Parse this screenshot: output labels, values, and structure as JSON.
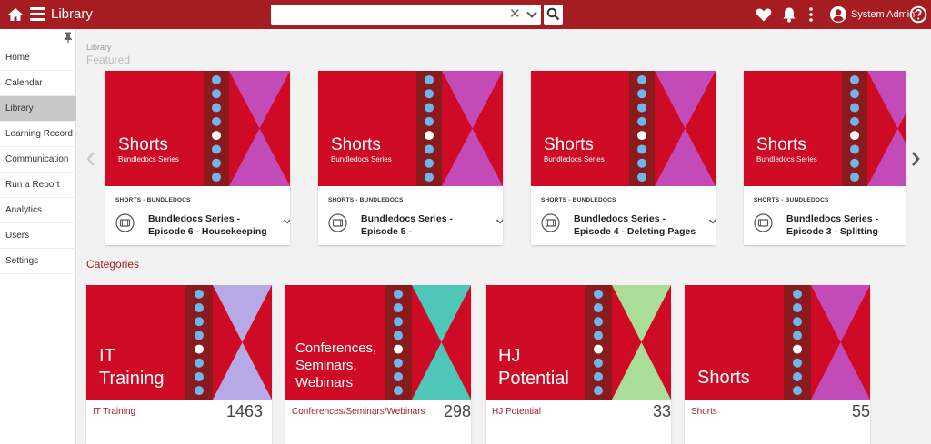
{
  "header": {
    "title": "Library",
    "user_name": "System Admin",
    "search": {
      "value": "",
      "placeholder": ""
    }
  },
  "sidebar": {
    "items": [
      {
        "label": "Home",
        "active": false
      },
      {
        "label": "Calendar",
        "active": false
      },
      {
        "label": "Library",
        "active": true
      },
      {
        "label": "Learning Record",
        "active": false
      },
      {
        "label": "Communication",
        "active": false
      },
      {
        "label": "Run a Report",
        "active": false
      },
      {
        "label": "Analytics",
        "active": false
      },
      {
        "label": "Users",
        "active": false
      },
      {
        "label": "Settings",
        "active": false
      }
    ]
  },
  "main": {
    "breadcrumb": "Library",
    "featured_heading": "Featured",
    "categories_heading": "Categories",
    "featured": [
      {
        "thumb_title": "Shorts",
        "thumb_subtitle": "Bundledocs Series",
        "tag": "SHORTS - BUNDLEDOCS",
        "title_line1": "Bundledocs Series -",
        "title_line2": "Episode 6 - Housekeeping"
      },
      {
        "thumb_title": "Shorts",
        "thumb_subtitle": "Bundledocs Series",
        "tag": "SHORTS - BUNDLEDOCS",
        "title_line1": "Bundledocs Series -",
        "title_line2": "Episode 5 -"
      },
      {
        "thumb_title": "Shorts",
        "thumb_subtitle": "Bundledocs Series",
        "tag": "SHORTS - BUNDLEDOCS",
        "title_line1": "Bundledocs Series -",
        "title_line2": "Episode 4 - Deleting Pages"
      },
      {
        "thumb_title": "Shorts",
        "thumb_subtitle": "Bundledocs Series",
        "tag": "SHORTS - BUNDLEDOCS",
        "title_line1": "Bundledocs Series -",
        "title_line2": "Episode 3 - Splitting"
      }
    ],
    "categories": [
      {
        "thumb_lines": [
          "IT",
          "Training"
        ],
        "name": "IT Training",
        "count": "1463",
        "accent": "#b6a9e6"
      },
      {
        "thumb_lines": [
          "Conferences,",
          "Seminars,",
          "Webinars"
        ],
        "name": "Conferences/Seminars/Webinars",
        "count": "298",
        "accent": "#4ec7b9"
      },
      {
        "thumb_lines": [
          "HJ",
          "Potential"
        ],
        "name": "HJ Potential",
        "count": "33",
        "accent": "#a9dd98"
      },
      {
        "thumb_lines": [
          "Shorts"
        ],
        "name": "Shorts",
        "count": "55",
        "accent": "#c34bb8"
      }
    ]
  },
  "colors": {
    "brand_red": "#a51c21",
    "thumb_red": "#cf0a24",
    "strip_dark": "#8a1a1c",
    "dot_blue": "#6fb6ec",
    "featured_accent": "#c34bb8"
  }
}
